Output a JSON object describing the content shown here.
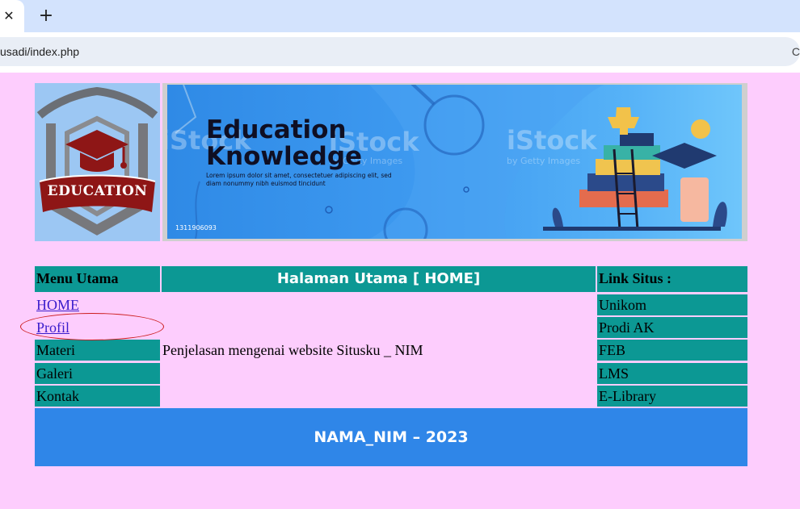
{
  "browser": {
    "tab_close_glyph": "✕",
    "new_tab_glyph": "+",
    "url": "usadi/index.php",
    "right_glyph": "C"
  },
  "colors": {
    "page_bg": "#fdcdfd",
    "teal": "#0c9894",
    "footer_blue": "#2f86e8",
    "link": "#3a1dcc",
    "annotation": "#cc1c1c"
  },
  "logo": {
    "text": "EDUCATION"
  },
  "banner": {
    "title_line1": "Education",
    "title_line2": "Knowledge",
    "description": "Lorem ipsum dolor sit amet, consectetuer adipiscing elit, sed diam nonummy nibh euismod tincidunt",
    "watermark": "iStock",
    "watermark_sub": "by Getty Images",
    "stock_code": "1311906093"
  },
  "menu": {
    "header": "Menu Utama",
    "items": [
      {
        "label": "HOME",
        "link": true
      },
      {
        "label": "Profil",
        "link": true
      },
      {
        "label": "Materi",
        "link": false
      },
      {
        "label": "Galeri",
        "link": false
      },
      {
        "label": "Kontak",
        "link": false
      }
    ]
  },
  "main": {
    "header": "Halaman Utama [ HOME]",
    "content": "Penjelasan mengenai website Situsku _ NIM"
  },
  "links": {
    "header": "Link Situs :",
    "items": [
      "Unikom",
      "Prodi AK",
      "FEB",
      "LMS",
      "E-Library"
    ]
  },
  "footer": {
    "text": "NAMA_NIM – 2023"
  }
}
